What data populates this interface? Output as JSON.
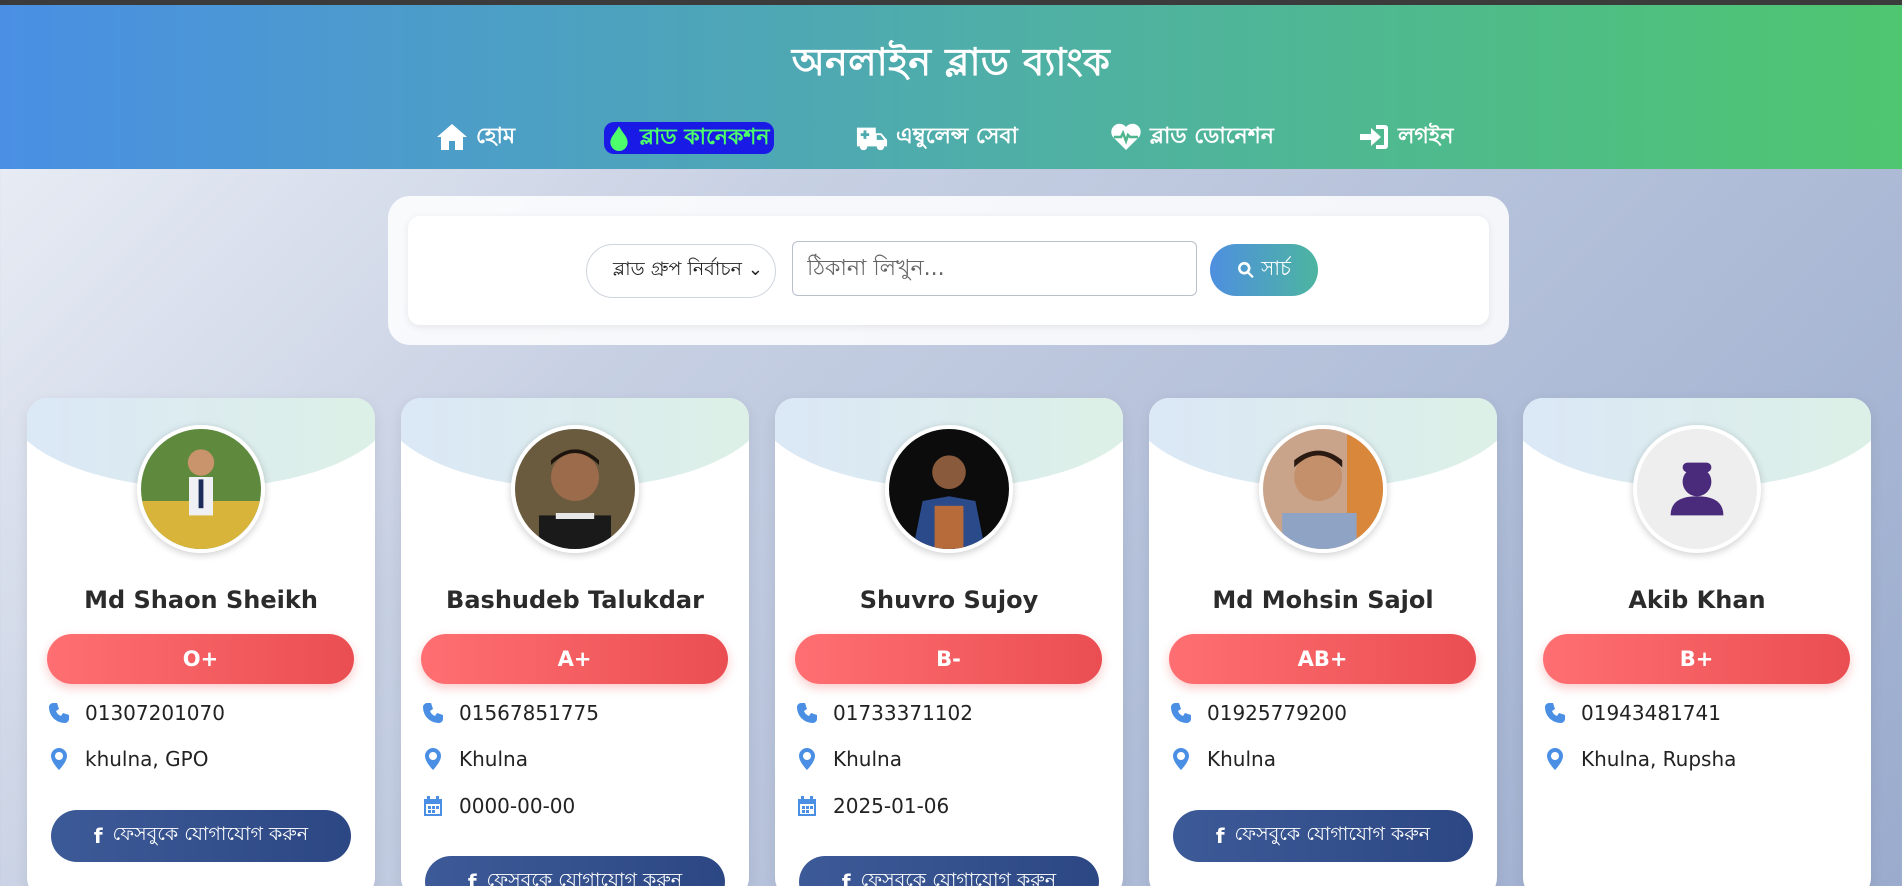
{
  "header": {
    "title": "অনলাইন ব্লাড ব্যাংক",
    "nav": [
      {
        "label": "হোম",
        "icon": "home-icon"
      },
      {
        "label": "ব্লাড কানেকশন",
        "icon": "blood-drop-icon"
      },
      {
        "label": "এম্বুলেন্স সেবা",
        "icon": "ambulance-icon"
      },
      {
        "label": "ব্লাড ডোনেশন",
        "icon": "heart-pulse-icon"
      },
      {
        "label": "লগইন",
        "icon": "login-icon"
      }
    ]
  },
  "search": {
    "blood_group_select": "ব্লাড গ্রুপ নির্বাচন",
    "address_placeholder": "ঠিকানা লিখুন...",
    "button_label": "সার্চ"
  },
  "donors": [
    {
      "name": "Md Shaon Sheikh",
      "blood_group": "O+",
      "phone": "01307201070",
      "location": "khulna, GPO",
      "facebook_label": "ফেসবুকে যোগাযোগ করুন"
    },
    {
      "name": "Bashudeb Talukdar",
      "blood_group": "A+",
      "phone": "01567851775",
      "location": "Khulna",
      "date": "0000-00-00",
      "facebook_label": "ফেসবুকে যোগাযোগ করুন"
    },
    {
      "name": "Shuvro Sujoy",
      "blood_group": "B-",
      "phone": "01733371102",
      "location": "Khulna",
      "date": "2025-01-06",
      "facebook_label": "ফেসবুকে যোগাযোগ করুন"
    },
    {
      "name": "Md Mohsin Sajol",
      "blood_group": "AB+",
      "phone": "01925779200",
      "location": "Khulna",
      "facebook_label": "ফেসবুকে যোগাযোগ করুন"
    },
    {
      "name": "Akib Khan",
      "blood_group": "B+",
      "phone": "01943481741",
      "location": "Khulna, Rupsha"
    }
  ],
  "colors": {
    "header_start": "#4a8fe4",
    "header_end": "#4fc670",
    "blood_pill": "#ef5a5e",
    "facebook": "#334f8d",
    "icon_blue": "#4a8fe4"
  }
}
